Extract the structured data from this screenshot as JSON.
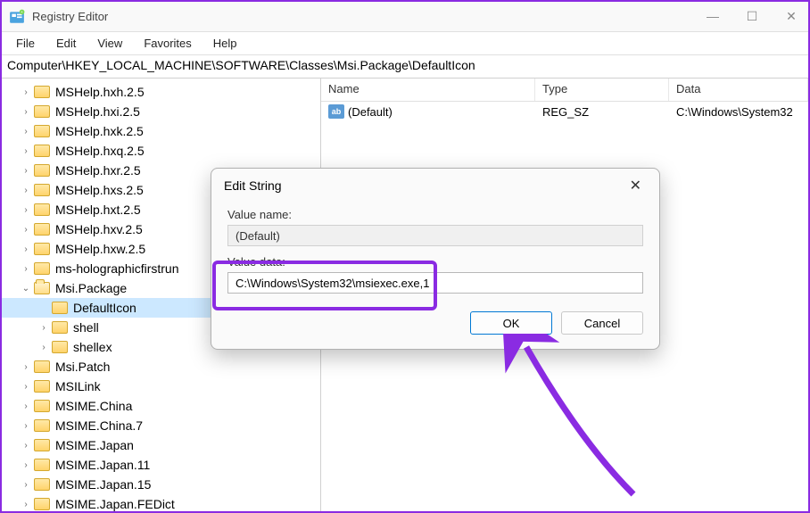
{
  "window": {
    "title": "Registry Editor"
  },
  "menu": {
    "file": "File",
    "edit": "Edit",
    "view": "View",
    "favorites": "Favorites",
    "help": "Help"
  },
  "address": "Computer\\HKEY_LOCAL_MACHINE\\SOFTWARE\\Classes\\Msi.Package\\DefaultIcon",
  "tree": [
    {
      "label": "MSHelp.hxh.2.5",
      "chev": ">"
    },
    {
      "label": "MSHelp.hxi.2.5",
      "chev": ">"
    },
    {
      "label": "MSHelp.hxk.2.5",
      "chev": ">"
    },
    {
      "label": "MSHelp.hxq.2.5",
      "chev": ">"
    },
    {
      "label": "MSHelp.hxr.2.5",
      "chev": ">"
    },
    {
      "label": "MSHelp.hxs.2.5",
      "chev": ">"
    },
    {
      "label": "MSHelp.hxt.2.5",
      "chev": ">"
    },
    {
      "label": "MSHelp.hxv.2.5",
      "chev": ">"
    },
    {
      "label": "MSHelp.hxw.2.5",
      "chev": ">"
    },
    {
      "label": "ms-holographicfirstrun",
      "chev": ">"
    },
    {
      "label": "Msi.Package",
      "chev": "v",
      "open": true,
      "sub": [
        {
          "label": "DefaultIcon",
          "selected": true,
          "chev": ""
        },
        {
          "label": "shell",
          "chev": ">"
        },
        {
          "label": "shellex",
          "chev": ">"
        }
      ]
    },
    {
      "label": "Msi.Patch",
      "chev": ">"
    },
    {
      "label": "MSILink",
      "chev": ">"
    },
    {
      "label": "MSIME.China",
      "chev": ">"
    },
    {
      "label": "MSIME.China.7",
      "chev": ">"
    },
    {
      "label": "MSIME.Japan",
      "chev": ">"
    },
    {
      "label": "MSIME.Japan.11",
      "chev": ">"
    },
    {
      "label": "MSIME.Japan.15",
      "chev": ">"
    },
    {
      "label": "MSIME.Japan.FEDict",
      "chev": ">"
    }
  ],
  "list": {
    "headers": {
      "name": "Name",
      "type": "Type",
      "data": "Data"
    },
    "rows": [
      {
        "name": "(Default)",
        "type": "REG_SZ",
        "data": "C:\\Windows\\System32"
      }
    ],
    "icon_text": "ab"
  },
  "dialog": {
    "title": "Edit String",
    "value_name_label": "Value name:",
    "value_name": "(Default)",
    "value_data_label": "Value data:",
    "value_data": "C:\\Windows\\System32\\msiexec.exe,1",
    "ok": "OK",
    "cancel": "Cancel"
  }
}
